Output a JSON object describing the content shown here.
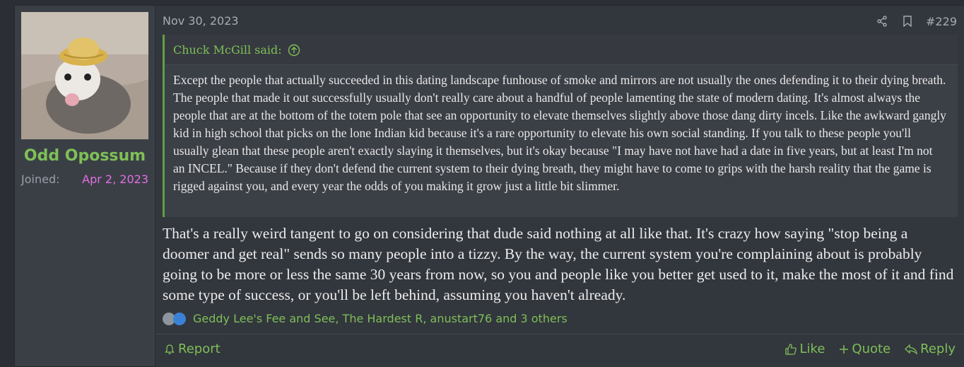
{
  "user": {
    "name": "Odd Opossum",
    "joined_label": "Joined:",
    "joined_date": "Apr 2, 2023",
    "avatar_icon": "opossum-avatar"
  },
  "post": {
    "date": "Nov 30, 2023",
    "number": "#229",
    "quote": {
      "author": "Chuck McGill said:",
      "text": "Except the people that actually succeeded in this dating landscape funhouse of smoke and mirrors are not usually the ones defending it to their dying breath. The people that made it out successfully usually don't really care about a handful of people lamenting the state of modern dating. It's almost always the people that are at the bottom of the totem pole that see an opportunity to elevate themselves slightly above those dang dirty incels. Like the awkward gangly kid in high school that picks on the lone Indian kid because it's a rare opportunity to elevate his own social standing. If you talk to these people you'll usually glean that these people aren't exactly slaying it themselves, but it's okay because \"I may have not have had a date in five years, but at least I'm not an INCEL.\" Because if they don't defend the current system to their dying breath, they might have to come to grips with the harsh reality that the game is rigged against you, and every year the odds of you making it grow just a little bit slimmer."
    },
    "message": "That's a really weird tangent to go on considering that dude said nothing at all like that. It's crazy how saying \"stop being a doomer and get real\" sends so many people into a tizzy. By the way, the current system you're complaining about is probably going to be more or less the same 30 years from now, so you and people like you better get used to it, make the most of it and find some type of success, or you'll be left behind, assuming you haven't already.",
    "reactions_text": "Geddy Lee's Fee and See, The Hardest R, anustart76 and 3 others"
  },
  "footer": {
    "report": "Report",
    "like": "Like",
    "quote": "Quote",
    "reply": "Reply"
  },
  "colors": {
    "accent_green": "#7fbf57",
    "joined_date_pink": "#e36de3",
    "background": "#32363d"
  }
}
